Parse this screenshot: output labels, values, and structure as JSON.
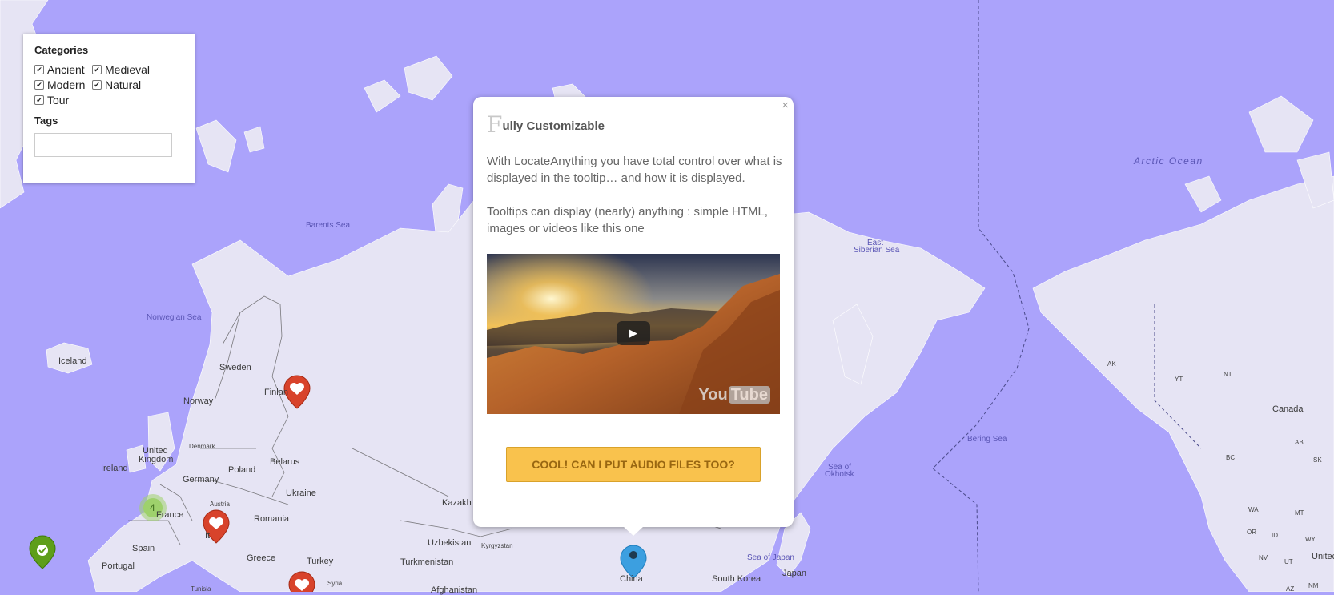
{
  "filter": {
    "categories_title": "Categories",
    "categories": [
      {
        "label": "Ancient",
        "checked": true
      },
      {
        "label": "Medieval",
        "checked": true
      },
      {
        "label": "Modern",
        "checked": true
      },
      {
        "label": "Natural",
        "checked": true
      },
      {
        "label": "Tour",
        "checked": true
      }
    ],
    "tags_title": "Tags",
    "tags_value": ""
  },
  "popup": {
    "close_icon": "×",
    "title_dropcap": "F",
    "title_rest": "ully Customizable",
    "paragraph1": "With LocateAnything you have total control over what is displayed in the tooltip… and how it is displayed.",
    "paragraph2": "Tooltips can display (nearly) anything : simple HTML, images or videos like this one",
    "video": {
      "play_icon": "▶",
      "logo_you": "You",
      "logo_tube": "Tube"
    },
    "button_label": "COOL! CAN I PUT AUDIO FILES  TOO?"
  },
  "cluster": {
    "count": "4"
  },
  "map_labels": {
    "arctic_ocean": "Arctic Ocean",
    "barents_sea": "Barents Sea",
    "norwegian_sea": "Norwegian Sea",
    "east_siberian_sea_1": "East",
    "east_siberian_sea_2": "Siberian Sea",
    "bering_sea": "Bering Sea",
    "sea_of_okhotsk_1": "Sea of",
    "sea_of_okhotsk_2": "Okhotsk",
    "sea_of_japan": "Sea of Japan",
    "iceland": "Iceland",
    "sweden": "Sweden",
    "finland": "Finlan",
    "norway": "Norway",
    "denmark": "Denmark",
    "united_kingdom_1": "United",
    "united_kingdom_2": "Kingdom",
    "ireland": "Ireland",
    "poland": "Poland",
    "belarus": "Belarus",
    "germany": "Germany",
    "austria": "Austria",
    "ukraine": "Ukraine",
    "france": "France",
    "romania": "Romania",
    "spain": "Spain",
    "portugal": "Portugal",
    "italy": "It",
    "greece": "Greece",
    "turkey": "Turkey",
    "syria": "Syria",
    "tunisia": "Tunisia",
    "kazakhstan": "Kazakh",
    "uzbekistan": "Uzbekistan",
    "kyrgyzstan": "Kyrgyzstan",
    "turkmenistan": "Turkmenistan",
    "afghanistan": "Afghanistan",
    "china": "China",
    "south_korea": "South Korea",
    "japan": "Japan",
    "canada": "Canada",
    "united_states": "Unitec",
    "ak": "AK",
    "yt": "YT",
    "nt": "NT",
    "ab": "AB",
    "bc": "BC",
    "sk": "SK",
    "wa": "WA",
    "mt": "MT",
    "or": "OR",
    "id": "ID",
    "wy": "WY",
    "nv": "NV",
    "ut": "UT",
    "nm": "NM",
    "az": "AZ"
  },
  "colors": {
    "water": "#aba3fb",
    "land": "#e6e4f4",
    "marker_red": "#d8432b",
    "marker_green": "#5e9e1a",
    "marker_blue": "#3c9fe0",
    "cluster": "#9ed16c",
    "button": "#f9c24d"
  }
}
